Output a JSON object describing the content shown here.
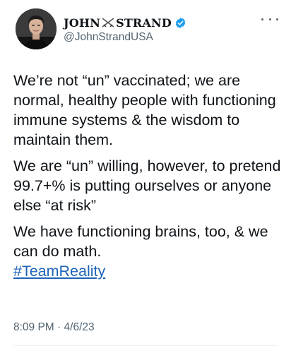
{
  "tweet": {
    "author": {
      "name_first": "JOHN",
      "name_last": "STRAND",
      "handle": "@JohnStrandUSA",
      "verified_color": "#1d9bf0"
    },
    "paragraphs": [
      "We’re not “un” vaccinated; we are normal, healthy people with functioning immune systems & the wisdom to maintain them.",
      "We are “un” willing, however, to pretend 99.7+% is putting ourselves or anyone else “at risk”",
      "We have functioning brains, too, & we can do math."
    ],
    "hashtag": "#TeamReality",
    "time": "8:09 PM",
    "separator": "·",
    "date": "4/6/23"
  },
  "icons": {
    "more": "more-horizontal-icon",
    "verified": "verified-badge-icon",
    "swords": "crossed-swords-icon"
  },
  "colors": {
    "link": "#1d64b8",
    "secondary_text": "#536471",
    "primary_text": "#0f1419"
  }
}
